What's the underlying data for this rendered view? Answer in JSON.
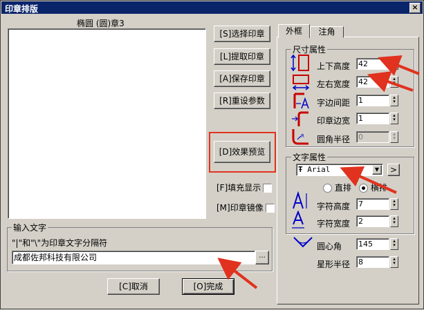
{
  "window": {
    "title": "印章排版",
    "close": "×"
  },
  "preview": {
    "title": "椭圆 (圆)章3"
  },
  "buttons": {
    "select": "[S]选择印章",
    "extract": "[L]提取印章",
    "save": "[A]保存印章",
    "reset": "[R]重设参数",
    "preview": "[D]效果预览",
    "cancel": "[C]取消",
    "done": "[O]完成",
    "browse": "..."
  },
  "checks": {
    "fill": "[F]填充显示",
    "mirror": "[M]印章镜像"
  },
  "input_group": {
    "label": "输入文字",
    "hint": "\"|\"和\"\\\"为印章文字分隔符",
    "value": "成都佐邦科技有限公司"
  },
  "tabs": [
    {
      "label": "外框"
    },
    {
      "label": "注角"
    }
  ],
  "size_group": {
    "label": "尺寸属性",
    "rows": [
      {
        "label": "上下高度",
        "value": "42"
      },
      {
        "label": "左右宽度",
        "value": "42"
      },
      {
        "label": "字边间距",
        "value": "1"
      },
      {
        "label": "印章边宽",
        "value": "1"
      },
      {
        "label": "圆角半径",
        "value": "0"
      }
    ]
  },
  "text_group": {
    "label": "文字属性",
    "font": "Arial",
    "font_prefix": "Ŧ",
    "more": ">",
    "radio_vertical": "直排",
    "radio_horizontal": "横排",
    "rows": [
      {
        "label": "字符高度",
        "value": "7"
      },
      {
        "label": "字符宽度",
        "value": "2"
      }
    ]
  },
  "extra": [
    {
      "label": "圆心角",
      "value": "145"
    },
    {
      "label": "星形半径",
      "value": "8"
    }
  ],
  "colors": {
    "accent": "#e0321e",
    "title_bg": "#0a246a",
    "icon_blue": "#0000c8",
    "icon_red": "#c80000"
  }
}
